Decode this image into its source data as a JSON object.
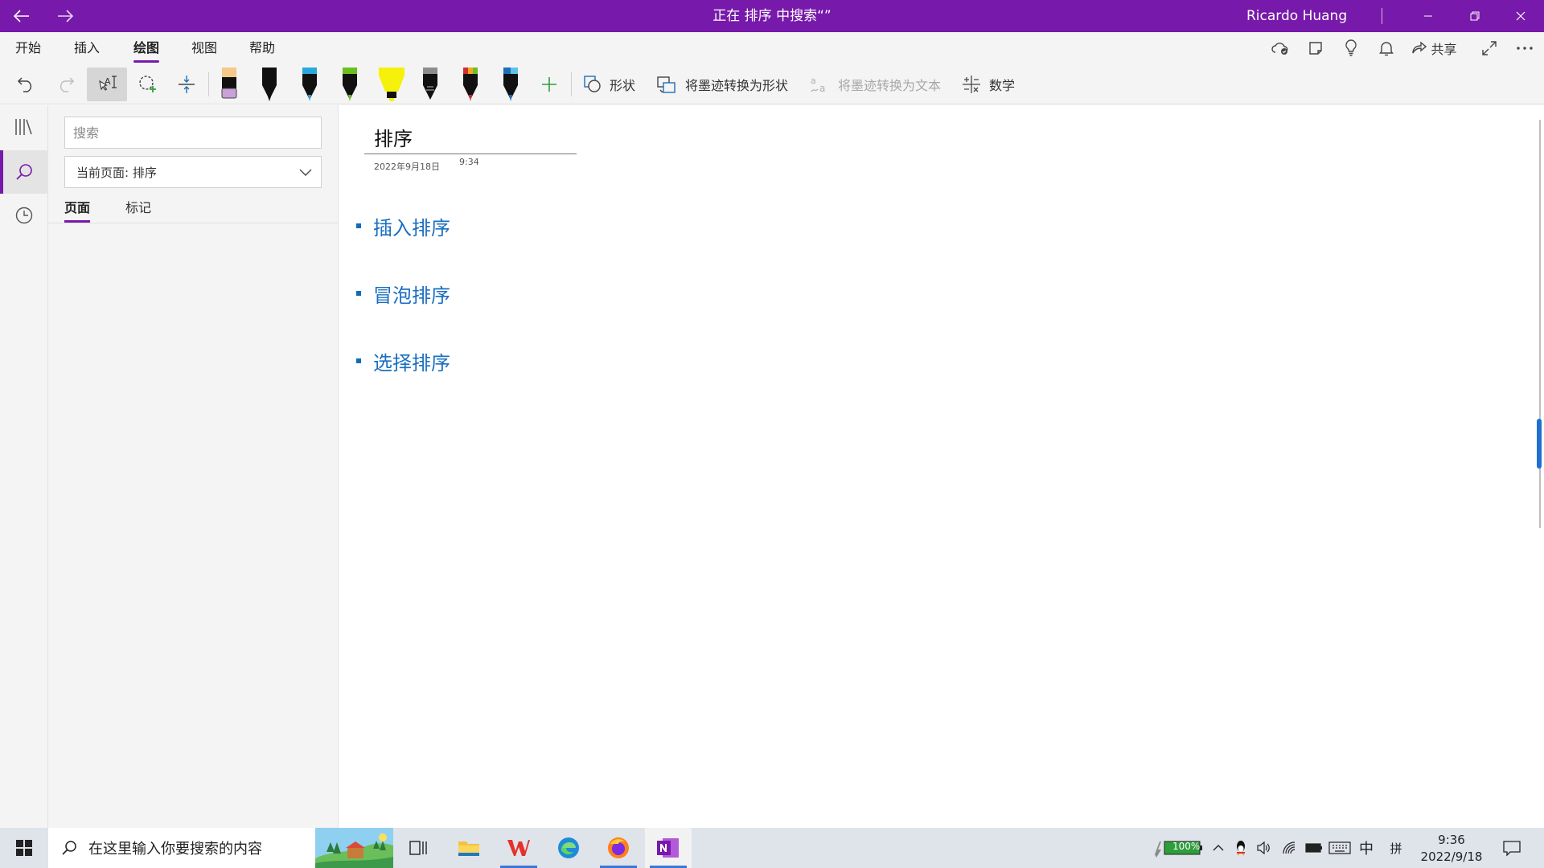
{
  "titlebar": {
    "title": "正在 排序 中搜索“”",
    "user": "Ricardo Huang"
  },
  "menu": {
    "tabs": [
      "开始",
      "插入",
      "绘图",
      "视图",
      "帮助"
    ],
    "active_tab": "绘图",
    "share_label": "共享"
  },
  "toolbar": {
    "shapes_label": "形状",
    "ink_to_shape_label": "将墨迹转换为形状",
    "ink_to_text_label": "将墨迹转换为文本",
    "math_label": "数学",
    "pens": [
      {
        "name": "pen-lavender",
        "color": "#caa0d9"
      },
      {
        "name": "pen-black-1",
        "color": "#111111"
      },
      {
        "name": "pen-cyan",
        "color": "#29a8e0"
      },
      {
        "name": "pen-green",
        "color": "#6bbf1f"
      },
      {
        "name": "highlighter-yellow",
        "color": "#f5f10a"
      },
      {
        "name": "pen-galaxy",
        "color": "#5a5a5a"
      },
      {
        "name": "pen-red",
        "color": "#d32f2f"
      },
      {
        "name": "pen-ocean",
        "color": "#1f6fb5"
      }
    ]
  },
  "search_pane": {
    "placeholder": "搜索",
    "scope": "当前页面: 排序",
    "tabs": [
      "页面",
      "标记"
    ],
    "active_tab": "页面"
  },
  "page": {
    "title": "排序",
    "date": "2022年9月18日",
    "time": "9:34",
    "items": [
      "插入排序",
      "冒泡排序",
      "选择排序"
    ]
  },
  "taskbar": {
    "search_placeholder": "在这里输入你要搜索的内容",
    "battery": "100%",
    "ime_lang": "中",
    "ime_mode": "拼",
    "time": "9:36",
    "date": "2022/9/18"
  },
  "colors": {
    "accent": "#7719AA",
    "link_blue": "#1a6fc1"
  }
}
